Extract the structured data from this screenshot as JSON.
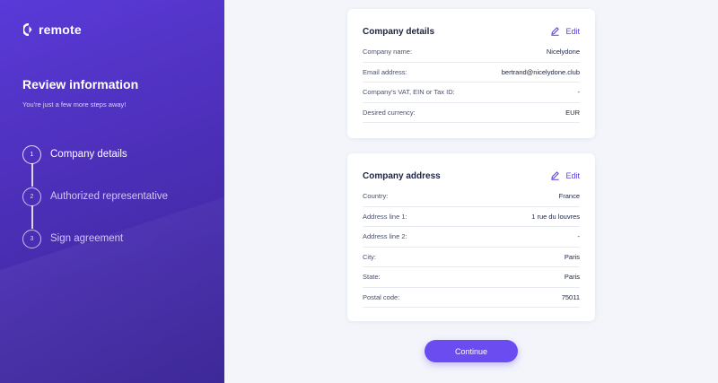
{
  "brand": {
    "name": "remote"
  },
  "sidebar": {
    "title": "Review information",
    "subtitle": "You're just a few more steps away!",
    "steps": [
      {
        "number": "1",
        "label": "Company details",
        "state": "active"
      },
      {
        "number": "2",
        "label": "Authorized representative",
        "state": "upcoming"
      },
      {
        "number": "3",
        "label": "Sign agreement",
        "state": "upcoming"
      }
    ]
  },
  "company_details": {
    "title": "Company details",
    "edit_label": "Edit",
    "rows": [
      {
        "label": "Company name:",
        "value": "Nicelydone"
      },
      {
        "label": "Email address:",
        "value": "bertrand@nicelydone.club"
      },
      {
        "label": "Company's VAT, EIN or Tax ID:",
        "value": "-"
      },
      {
        "label": "Desired currency:",
        "value": "EUR"
      }
    ]
  },
  "company_address": {
    "title": "Company address",
    "edit_label": "Edit",
    "rows": [
      {
        "label": "Country:",
        "value": "France"
      },
      {
        "label": "Address line 1:",
        "value": "1 rue du louvres"
      },
      {
        "label": "Address line 2:",
        "value": "-"
      },
      {
        "label": "City:",
        "value": "Paris"
      },
      {
        "label": "State:",
        "value": "Paris"
      },
      {
        "label": "Postal code:",
        "value": "75011"
      }
    ]
  },
  "actions": {
    "continue_label": "Continue"
  },
  "colors": {
    "accent": "#6b4cf0",
    "sidebar_start": "#5a3ad8",
    "sidebar_end": "#3a2596"
  }
}
